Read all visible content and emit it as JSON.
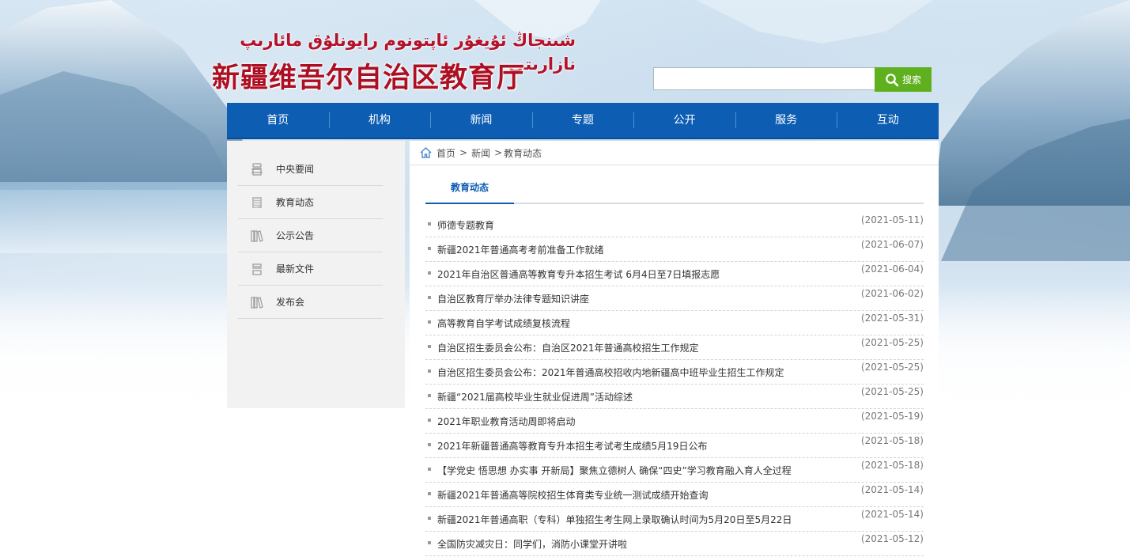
{
  "header": {
    "uyghur_title": "شىنجاڭ ئۇيغۇر ئاپتونوم رايونلۇق مائارىپ نازارىتى",
    "title": "新疆维吾尔自治区教育厅"
  },
  "search": {
    "placeholder": "",
    "button_label": "搜索"
  },
  "nav": {
    "items": [
      "首页",
      "机构",
      "新闻",
      "专题",
      "公开",
      "服务",
      "互动"
    ]
  },
  "sidebar": {
    "items": [
      {
        "label": "中央要闻",
        "icon": "news-icon"
      },
      {
        "label": "教育动态",
        "icon": "document-icon"
      },
      {
        "label": "公示公告",
        "icon": "books-icon"
      },
      {
        "label": "最新文件",
        "icon": "file-icon"
      },
      {
        "label": "发布会",
        "icon": "books-icon"
      }
    ]
  },
  "breadcrumb": {
    "home": "首页",
    "sep1": ">",
    "level1": "新闻",
    "sep2": ">",
    "level2": "教育动态"
  },
  "tab": {
    "label": "教育动态"
  },
  "news": [
    {
      "title": "师德专题教育",
      "date": "(2021-05-11)"
    },
    {
      "title": "新疆2021年普通高考考前准备工作就绪",
      "date": "(2021-06-07)"
    },
    {
      "title": "2021年自治区普通高等教育专升本招生考试 6月4日至7日填报志愿",
      "date": "(2021-06-04)"
    },
    {
      "title": "自治区教育厅举办法律专题知识讲座",
      "date": "(2021-06-02)"
    },
    {
      "title": "高等教育自学考试成绩复核流程",
      "date": "(2021-05-31)"
    },
    {
      "title": "自治区招生委员会公布：自治区2021年普通高校招生工作规定",
      "date": "(2021-05-25)"
    },
    {
      "title": "自治区招生委员会公布：2021年普通高校招收内地新疆高中班毕业生招生工作规定",
      "date": "(2021-05-25)"
    },
    {
      "title": "新疆“2021届高校毕业生就业促进周”活动综述",
      "date": "(2021-05-25)"
    },
    {
      "title": "2021年职业教育活动周即将启动",
      "date": "(2021-05-19)"
    },
    {
      "title": "2021年新疆普通高等教育专升本招生考试考生成绩5月19日公布",
      "date": "(2021-05-18)"
    },
    {
      "title": "【学党史 悟思想 办实事 开新局】聚焦立德树人 确保“四史”学习教育融入育人全过程",
      "date": "(2021-05-18)"
    },
    {
      "title": "新疆2021年普通高等院校招生体育类专业统一测试成绩开始查询",
      "date": "(2021-05-14)"
    },
    {
      "title": "新疆2021年普通高职（专科）单独招生考生网上录取确认时间为5月20日至5月22日",
      "date": "(2021-05-14)"
    },
    {
      "title": "全国防灾减灾日：同学们，消防小课堂开讲啦",
      "date": "(2021-05-12)"
    }
  ],
  "colors": {
    "nav_blue": "#0d5db3",
    "search_green": "#5fb01e",
    "title_red": "#ad0f22"
  }
}
